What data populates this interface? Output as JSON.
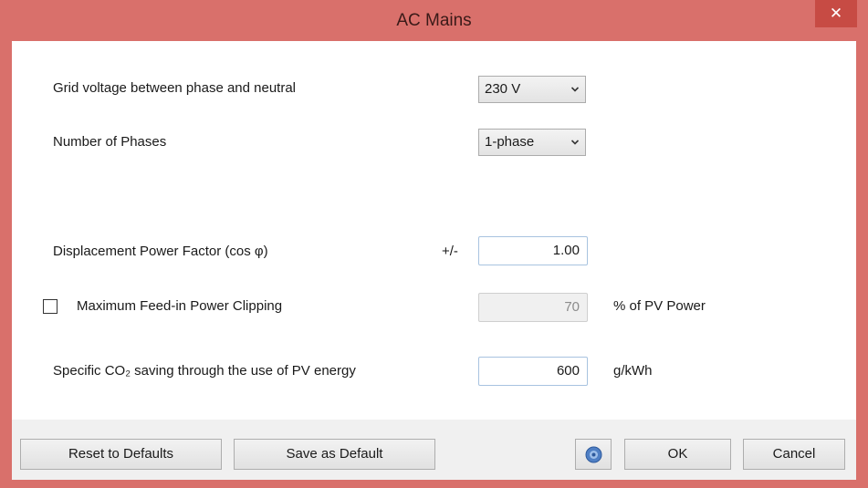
{
  "window": {
    "title": "AC Mains",
    "close_glyph": "✕",
    "accent_color": "#d9706b"
  },
  "grid_voltage": {
    "label": "Grid voltage between phase and neutral",
    "value": "230 V"
  },
  "phases": {
    "label": "Number of Phases",
    "value": "1-phase"
  },
  "power_factor": {
    "label": "Displacement Power Factor (cos φ)",
    "prefix": "+/-",
    "value": "1.00"
  },
  "feed_in_clipping": {
    "checked": false,
    "label": "Maximum Feed-in Power Clipping",
    "value": "70",
    "unit": "% of PV Power"
  },
  "co2_saving": {
    "label": "Specific CO₂ saving through the use of PV energy",
    "value": "600",
    "unit": "g/kWh"
  },
  "footer": {
    "reset_label": "Reset to Defaults",
    "save_default_label": "Save as Default",
    "help_icon": "help-icon",
    "ok_label": "OK",
    "cancel_label": "Cancel"
  }
}
